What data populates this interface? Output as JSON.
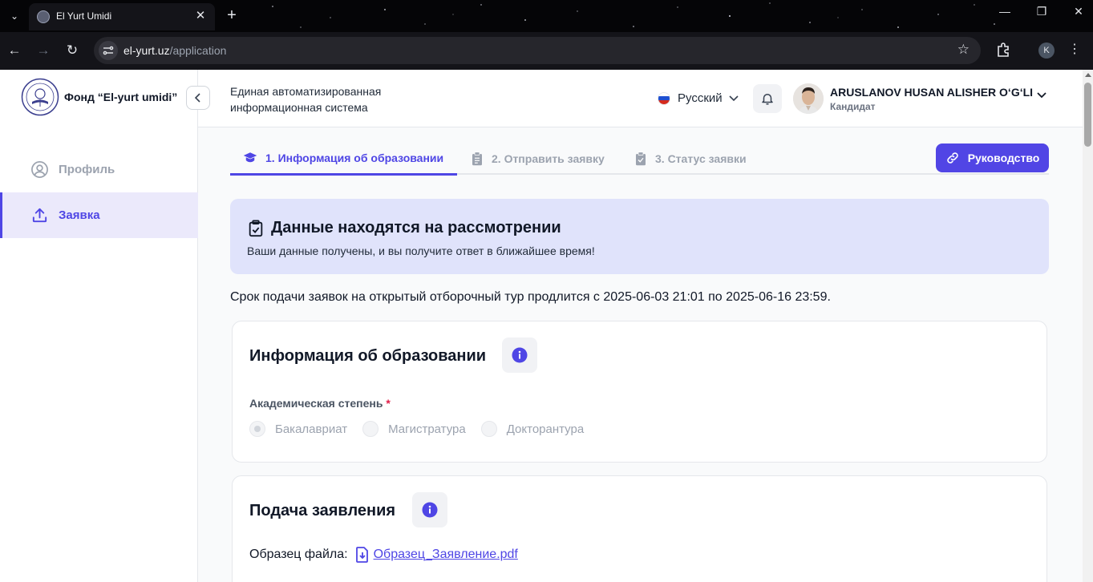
{
  "browser": {
    "tab_title": "El Yurt Umidi",
    "url_domain": "el-yurt.uz",
    "url_path": "/application",
    "profile_initial": "K"
  },
  "sidebar": {
    "brand": "Фонд “El-yurt umidi”",
    "items": [
      {
        "label": "Профиль",
        "icon": "user-circle-icon",
        "active": false
      },
      {
        "label": "Заявка",
        "icon": "upload-icon",
        "active": true
      }
    ]
  },
  "header": {
    "system_title": "Единая автоматизированная информационная система",
    "language": "Русский",
    "user_name": "ARUSLANOV HUSAN ALISHER O‘G‘LI",
    "user_role": "Кандидат"
  },
  "steps": [
    {
      "label": "1. Информация об образовании",
      "active": true
    },
    {
      "label": "2. Отправить заявку",
      "active": false
    },
    {
      "label": "3. Статус заявки",
      "active": false
    }
  ],
  "guide_button": "Руководство",
  "alert": {
    "title": "Данные находятся на рассмотрении",
    "text": "Ваши данные получены, и вы получите ответ в ближайшее время!"
  },
  "deadline_text": "Срок подачи заявок на открытый отборочный тур продлится с 2025-06-03 21:01 по 2025-06-16 23:59.",
  "education_card": {
    "title": "Информация об образовании",
    "field_label": "Академическая степень",
    "required_mark": "*",
    "options": [
      {
        "label": "Бакалавриат",
        "selected": true
      },
      {
        "label": "Магистратура",
        "selected": false
      },
      {
        "label": "Докторантура",
        "selected": false
      }
    ]
  },
  "application_card": {
    "title": "Подача заявления",
    "sample_label": "Образец файла:",
    "sample_file": "Образец_Заявление.pdf"
  },
  "colors": {
    "accent": "#4f46e5",
    "alert_bg": "#e0e3fb",
    "active_nav_bg": "#ebe9fb"
  }
}
